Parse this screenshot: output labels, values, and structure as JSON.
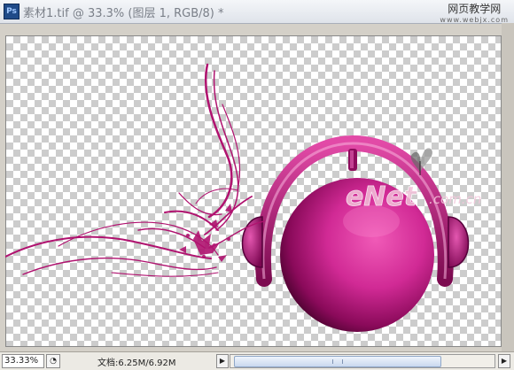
{
  "window": {
    "app_icon_label": "Ps",
    "title": "素材1.tif @ 33.3% (图层 1, RGB/8) *"
  },
  "watermark": {
    "site_cn": "网页教学网",
    "site_url": "www.webjx.com",
    "logo_text": "eNet",
    "logo_suffix": ".com.cn"
  },
  "status": {
    "zoom": "33.33%",
    "doc_info": "文档:6.25M/6.92M",
    "left_arrow": "◀",
    "right_arrow": "▶"
  },
  "colors": {
    "accent_magenta": "#b0126f",
    "checker_gray": "#cccccc"
  },
  "icons": {
    "status_menu": "status-menu-icon",
    "scroll_left": "scroll-left-icon",
    "scroll_right": "scroll-right-icon"
  }
}
